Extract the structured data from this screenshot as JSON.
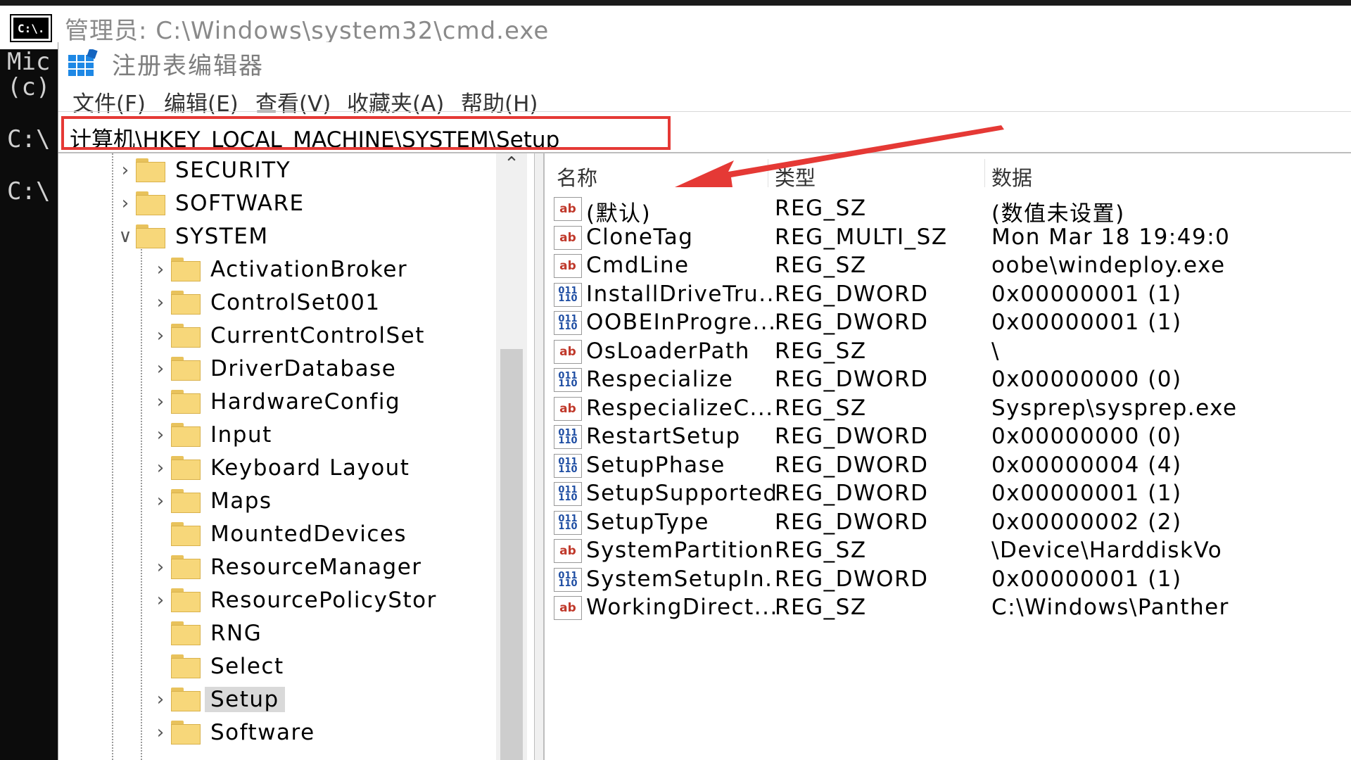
{
  "cmd": {
    "icon_text": "C:\\.",
    "title": "管理员: C:\\Windows\\system32\\cmd.exe",
    "console_lines": [
      "Mic",
      "(c)",
      "",
      "C:\\",
      "",
      "C:\\"
    ]
  },
  "regedit": {
    "title": "注册表编辑器",
    "menu": [
      "文件(F)",
      "编辑(E)",
      "查看(V)",
      "收藏夹(A)",
      "帮助(H)"
    ],
    "address": "计算机\\HKEY_LOCAL_MACHINE\\SYSTEM\\Setup",
    "tree": [
      {
        "label": "SECURITY",
        "expander": ">"
      },
      {
        "label": "SOFTWARE",
        "expander": ">"
      },
      {
        "label": "SYSTEM",
        "expander": "v"
      },
      {
        "label": "ActivationBroker",
        "expander": ">"
      },
      {
        "label": "ControlSet001",
        "expander": ">"
      },
      {
        "label": "CurrentControlSet",
        "expander": ">"
      },
      {
        "label": "DriverDatabase",
        "expander": ">"
      },
      {
        "label": "HardwareConfig",
        "expander": ">"
      },
      {
        "label": "Input",
        "expander": ">"
      },
      {
        "label": "Keyboard Layout",
        "expander": ">"
      },
      {
        "label": "Maps",
        "expander": ">"
      },
      {
        "label": "MountedDevices",
        "expander": ""
      },
      {
        "label": "ResourceManager",
        "expander": ">"
      },
      {
        "label": "ResourcePolicyStor",
        "expander": ">"
      },
      {
        "label": "RNG",
        "expander": ""
      },
      {
        "label": "Select",
        "expander": ""
      },
      {
        "label": "Setup",
        "expander": ">",
        "selected": true
      },
      {
        "label": "Software",
        "expander": ">"
      }
    ],
    "columns": [
      "名称",
      "类型",
      "数据"
    ],
    "values": [
      {
        "icon": "ab",
        "name": "(默认)",
        "type": "REG_SZ",
        "data": "(数值未设置)"
      },
      {
        "icon": "ab",
        "name": "CloneTag",
        "type": "REG_MULTI_SZ",
        "data": "Mon Mar 18 19:49:0"
      },
      {
        "icon": "ab",
        "name": "CmdLine",
        "type": "REG_SZ",
        "data": "oobe\\windeploy.exe"
      },
      {
        "icon": "bin",
        "name": "InstallDriveTru...",
        "type": "REG_DWORD",
        "data": "0x00000001 (1)"
      },
      {
        "icon": "bin",
        "name": "OOBEInProgre...",
        "type": "REG_DWORD",
        "data": "0x00000001 (1)"
      },
      {
        "icon": "ab",
        "name": "OsLoaderPath",
        "type": "REG_SZ",
        "data": "\\"
      },
      {
        "icon": "bin",
        "name": "Respecialize",
        "type": "REG_DWORD",
        "data": "0x00000000 (0)"
      },
      {
        "icon": "ab",
        "name": "RespecializeC...",
        "type": "REG_SZ",
        "data": "Sysprep\\sysprep.exe"
      },
      {
        "icon": "bin",
        "name": "RestartSetup",
        "type": "REG_DWORD",
        "data": "0x00000000 (0)"
      },
      {
        "icon": "bin",
        "name": "SetupPhase",
        "type": "REG_DWORD",
        "data": "0x00000004 (4)"
      },
      {
        "icon": "bin",
        "name": "SetupSupported",
        "type": "REG_DWORD",
        "data": "0x00000001 (1)"
      },
      {
        "icon": "bin",
        "name": "SetupType",
        "type": "REG_DWORD",
        "data": "0x00000002 (2)"
      },
      {
        "icon": "ab",
        "name": "SystemPartition",
        "type": "REG_SZ",
        "data": "\\Device\\HarddiskVo"
      },
      {
        "icon": "bin",
        "name": "SystemSetupIn...",
        "type": "REG_DWORD",
        "data": "0x00000001 (1)"
      },
      {
        "icon": "ab",
        "name": "WorkingDirect...",
        "type": "REG_SZ",
        "data": "C:\\Windows\\Panther"
      }
    ]
  },
  "colors": {
    "highlight_box": "#e53935",
    "folder": "#f7d77a",
    "selection": "#d9d9d9"
  }
}
